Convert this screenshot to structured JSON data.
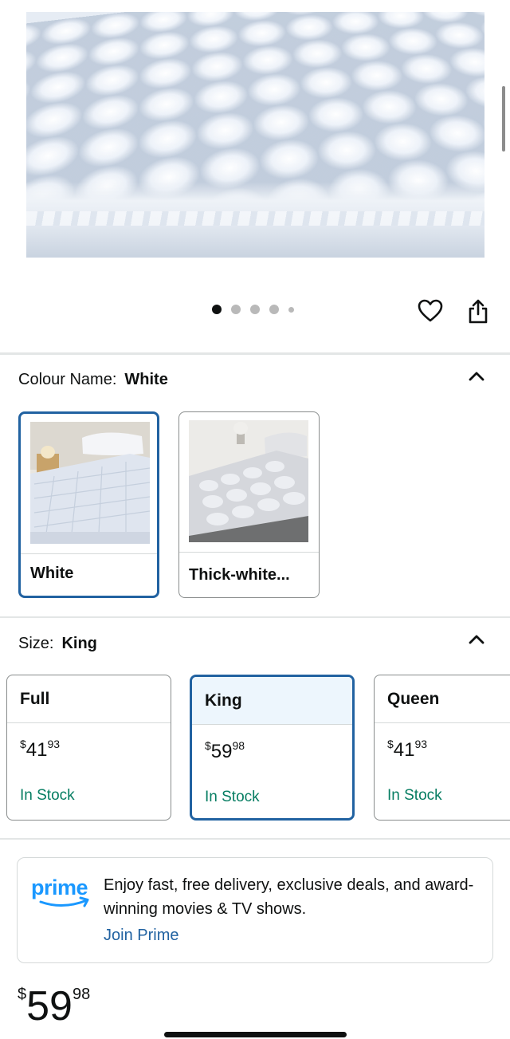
{
  "gallery": {
    "image_count": 5,
    "active_index": 0
  },
  "colour": {
    "label": "Colour Name:",
    "selected": "White",
    "options": [
      {
        "label": "White",
        "selected": true
      },
      {
        "label": "Thick-white...",
        "selected": false
      }
    ]
  },
  "size": {
    "label": "Size:",
    "selected": "King",
    "options": [
      {
        "name": "Full",
        "currency": "$",
        "whole": "41",
        "fraction": "93",
        "stock": "In Stock",
        "selected": false
      },
      {
        "name": "King",
        "currency": "$",
        "whole": "59",
        "fraction": "98",
        "stock": "In Stock",
        "selected": true
      },
      {
        "name": "Queen",
        "currency": "$",
        "whole": "41",
        "fraction": "93",
        "stock": "In Stock",
        "selected": false
      }
    ]
  },
  "prime": {
    "logo_text": "prime",
    "message": "Enjoy fast, free delivery, exclusive deals, and award-winning movies & TV shows.",
    "link": "Join Prime"
  },
  "price": {
    "currency": "$",
    "whole": "59",
    "fraction": "98"
  },
  "colors": {
    "link_blue": "#2162a1",
    "stock_green": "#067d62",
    "selected_border": "#2162a1",
    "selected_bg": "#edf6fd",
    "prime_blue": "#1a98ff"
  }
}
